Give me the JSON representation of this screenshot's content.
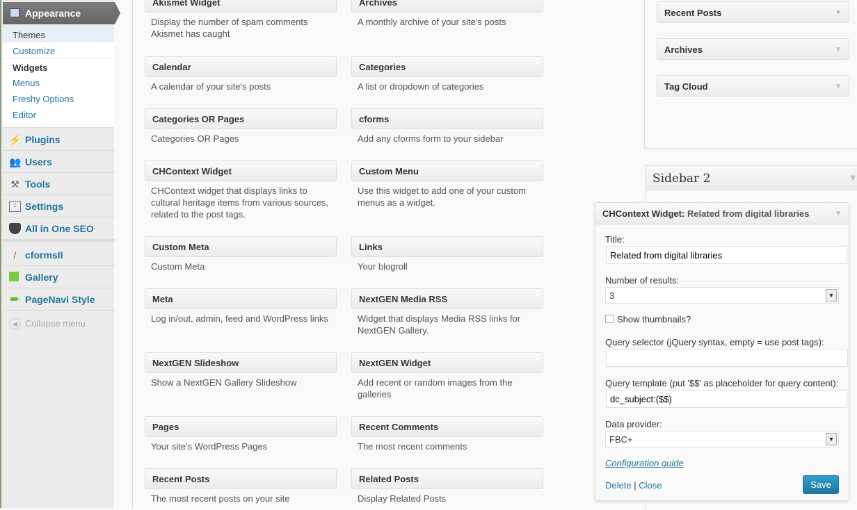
{
  "menu": {
    "appearance": "Appearance",
    "submenu": [
      "Themes",
      "Customize",
      "Widgets",
      "Menus",
      "Freshy Options",
      "Editor"
    ],
    "items": [
      {
        "label": "Plugins",
        "icon": "plug-icon"
      },
      {
        "label": "Users",
        "icon": "users-icon"
      },
      {
        "label": "Tools",
        "icon": "tools-icon"
      },
      {
        "label": "Settings",
        "icon": "settings-icon"
      },
      {
        "label": "All in One SEO",
        "icon": "shield-icon"
      },
      {
        "label": "cformsII",
        "icon": "cforms-icon"
      },
      {
        "label": "Gallery",
        "icon": "gallery-icon"
      },
      {
        "label": "PageNavi Style",
        "icon": "arrow-icon"
      }
    ],
    "collapse": "Collapse menu"
  },
  "widgets": [
    {
      "title": "Akismet Widget",
      "desc": "Display the number of spam comments Akismet has caught"
    },
    {
      "title": "Archives",
      "desc": "A monthly archive of your site's posts"
    },
    {
      "title": "Calendar",
      "desc": "A calendar of your site's posts"
    },
    {
      "title": "Categories",
      "desc": "A list or dropdown of categories"
    },
    {
      "title": "Categories OR Pages",
      "desc": "Categories OR Pages"
    },
    {
      "title": "cforms",
      "desc": "Add any cforms form to your sidebar"
    },
    {
      "title": "CHContext Widget",
      "desc": "CHContext widget that displays links to cultural heritage items from various sources, related to the post tags."
    },
    {
      "title": "Custom Menu",
      "desc": "Use this widget to add one of your custom menus as a widget."
    },
    {
      "title": "Custom Meta",
      "desc": "Custom Meta"
    },
    {
      "title": "Links",
      "desc": "Your blogroll"
    },
    {
      "title": "Meta",
      "desc": "Log in/out, admin, feed and WordPress links"
    },
    {
      "title": "NextGEN Media RSS",
      "desc": "Widget that displays Media RSS links for NextGEN Gallery."
    },
    {
      "title": "NextGEN Slideshow",
      "desc": "Show a NextGEN Gallery Slideshow"
    },
    {
      "title": "NextGEN Widget",
      "desc": "Add recent or random images from the galleries"
    },
    {
      "title": "Pages",
      "desc": "Your site's WordPress Pages"
    },
    {
      "title": "Recent Comments",
      "desc": "The most recent comments"
    },
    {
      "title": "Recent Posts",
      "desc": "The most recent posts on your site"
    },
    {
      "title": "Related Posts",
      "desc": "Display Related Posts"
    }
  ],
  "sidebar1": [
    "Recent Posts",
    "Archives",
    "Tag Cloud"
  ],
  "sidebar2": {
    "title": "Sidebar 2",
    "widget": {
      "name": "CHContext Widget:",
      "instance": "Related from digital libraries",
      "title_label": "Title:",
      "title_value": "Related from digital libraries",
      "num_label": "Number of results:",
      "num_value": "3",
      "thumbs_label": "Show thumbnails?",
      "thumbs_checked": false,
      "selector_label": "Query selector (jQuery syntax, empty = use post tags):",
      "selector_value": "",
      "template_label": "Query template (put '$$' as placeholder for query content):",
      "template_value": "dc_subject:($$)",
      "provider_label": "Data provider:",
      "provider_value": "FBC+",
      "guide": "Configuration guide",
      "delete": "Delete",
      "sep": "|",
      "close": "Close",
      "save": "Save"
    }
  }
}
